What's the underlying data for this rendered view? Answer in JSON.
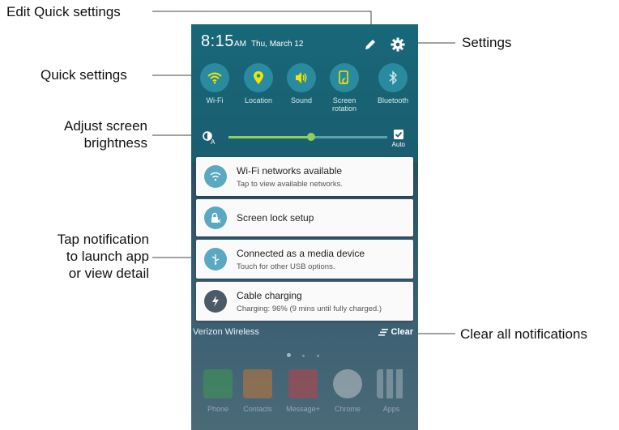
{
  "callouts": {
    "edit_quick_settings": "Edit Quick settings",
    "quick_settings": "Quick settings",
    "adjust_line1": "Adjust screen",
    "adjust_line2": "brightness",
    "tap_line1": "Tap notification",
    "tap_line2": "to launch app",
    "tap_line3": "or view detail",
    "settings": "Settings",
    "clear_all": "Clear all notifications"
  },
  "status": {
    "time": "8:15",
    "ampm": "AM",
    "date": "Thu, March 12"
  },
  "quick_settings": [
    {
      "label": "Wi-Fi",
      "icon": "wifi-icon",
      "color": "#f2e600"
    },
    {
      "label": "Location",
      "icon": "location-pin-icon",
      "color": "#f2e600"
    },
    {
      "label": "Sound",
      "icon": "speaker-icon",
      "color": "#f2e600"
    },
    {
      "label": "Screen",
      "label2": "rotation",
      "icon": "screen-rotation-icon",
      "color": "#f2e600"
    },
    {
      "label": "Bluetooth",
      "icon": "bluetooth-icon",
      "color": "#cfe6ea"
    }
  ],
  "brightness": {
    "level": 0.52,
    "auto_label": "Auto",
    "auto_checked": true
  },
  "notifications": [
    {
      "title": "Wi-Fi networks available",
      "detail": "Tap to view available networks.",
      "icon": "wifi-notification-icon",
      "color": "#5aa8c2"
    },
    {
      "title": "Screen lock setup",
      "detail": "",
      "icon": "screen-lock-icon",
      "color": "#5aa8c2"
    },
    {
      "title": "Connected as a media device",
      "detail": "Touch for other USB options.",
      "icon": "usb-icon",
      "color": "#5aa8c2"
    },
    {
      "title": "Cable charging",
      "detail": "Charging: 96% (9 mins until fully charged.)",
      "icon": "charging-bolt-icon",
      "color": "#4a5a66"
    }
  ],
  "footer": {
    "carrier": "Verizon Wireless",
    "clear_label": "Clear"
  },
  "dock": [
    {
      "label": "Phone",
      "color": "#3fa34d"
    },
    {
      "label": "Contacts",
      "color": "#e07a2e"
    },
    {
      "label": "Message+",
      "color": "#d83a3a"
    },
    {
      "label": "Chrome",
      "color": "#dcdcdc"
    },
    {
      "label": "Apps",
      "color": "#9aa3ad"
    }
  ]
}
